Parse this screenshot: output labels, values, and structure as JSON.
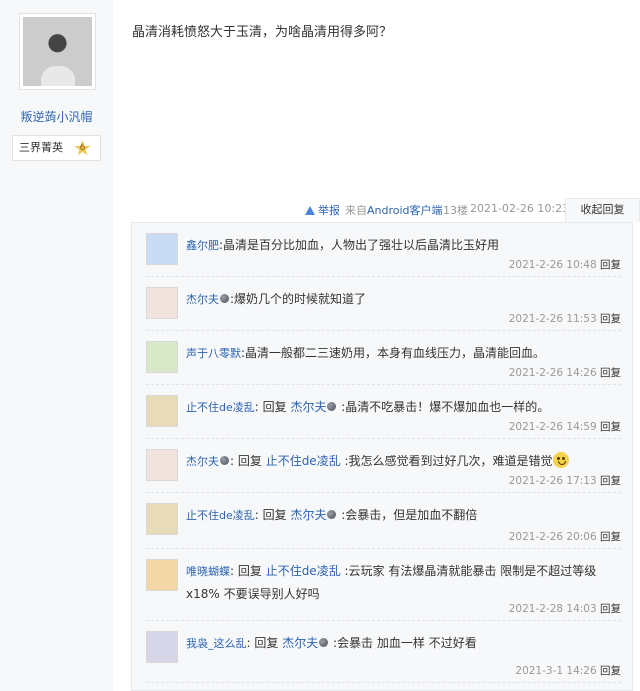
{
  "author": {
    "name": "叛逆蒟小汎帽",
    "rank": "三界菁英",
    "rank_level": "6"
  },
  "post": {
    "title": "晶清消耗愤怒大于玉清，为啥晶清用得多阿？"
  },
  "meta": {
    "report": "举报",
    "source_prefix": "来自",
    "source_app": "Android客户端",
    "floor": "13楼",
    "datetime": "2021-02-26 10:23",
    "collapse": "收起回复"
  },
  "replies": [
    {
      "user": "鑫尔肥",
      "parts": [
        {
          "t": "text",
          "v": ":晶清是百分比加血，人物出了强壮以后晶清比玉好用"
        }
      ],
      "time": "2021-2-26 10:48",
      "action": "回复",
      "avatar": "#c9dcf3"
    },
    {
      "user": "杰尔夫",
      "badge": true,
      "parts": [
        {
          "t": "text",
          "v": ":爆奶几个的时候就知道了"
        }
      ],
      "time": "2021-2-26 11:53",
      "action": "回复",
      "avatar": "#f1e4de"
    },
    {
      "user": "声于八零默",
      "parts": [
        {
          "t": "text",
          "v": ":晶清一般都二三速奶用，本身有血线压力，晶清能回血。"
        }
      ],
      "time": "2021-2-26 14:26",
      "action": "回复",
      "avatar": "#d9e9c8"
    },
    {
      "user": "止不住de凌乱",
      "parts": [
        {
          "t": "text",
          "v": ": 回复 "
        },
        {
          "t": "link",
          "v": "杰尔夫"
        },
        {
          "t": "dot"
        },
        {
          "t": "text",
          "v": " :晶清不吃暴击！爆不爆加血也一样的。"
        }
      ],
      "time": "2021-2-26 14:59",
      "action": "回复",
      "avatar": "#e8dcb8"
    },
    {
      "user": "杰尔夫",
      "badge": true,
      "parts": [
        {
          "t": "text",
          "v": ": 回复 "
        },
        {
          "t": "link",
          "v": "止不住de凌乱"
        },
        {
          "t": "text",
          "v": " :我怎么感觉看到过好几次，难道是错觉"
        },
        {
          "t": "emoji"
        }
      ],
      "time": "2021-2-26 17:13",
      "action": "回复",
      "avatar": "#f1e4de"
    },
    {
      "user": "止不住de凌乱",
      "parts": [
        {
          "t": "text",
          "v": ": 回复 "
        },
        {
          "t": "link",
          "v": "杰尔夫"
        },
        {
          "t": "dot"
        },
        {
          "t": "text",
          "v": " :会暴击，但是加血不翻倍"
        }
      ],
      "time": "2021-2-26 20:06",
      "action": "回复",
      "avatar": "#e8dcb8"
    },
    {
      "user": "唯晓蝴蝶",
      "parts": [
        {
          "t": "text",
          "v": ": 回复 "
        },
        {
          "t": "link",
          "v": "止不住de凌乱"
        },
        {
          "t": "text",
          "v": " :云玩家 有法爆晶清就能暴击 限制是不超过等级x18% 不要误导别人好吗"
        }
      ],
      "time": "2021-2-28 14:03",
      "action": "回复",
      "avatar": "#f3d7a6"
    },
    {
      "user": "我袅_这么乱",
      "parts": [
        {
          "t": "text",
          "v": ": 回复 "
        },
        {
          "t": "link",
          "v": "杰尔夫"
        },
        {
          "t": "dot"
        },
        {
          "t": "text",
          "v": " :会暴击 加血一样 不过好看"
        }
      ],
      "time": "2021-3-1 14:26",
      "action": "回复",
      "avatar": "#d6d6e8"
    }
  ]
}
